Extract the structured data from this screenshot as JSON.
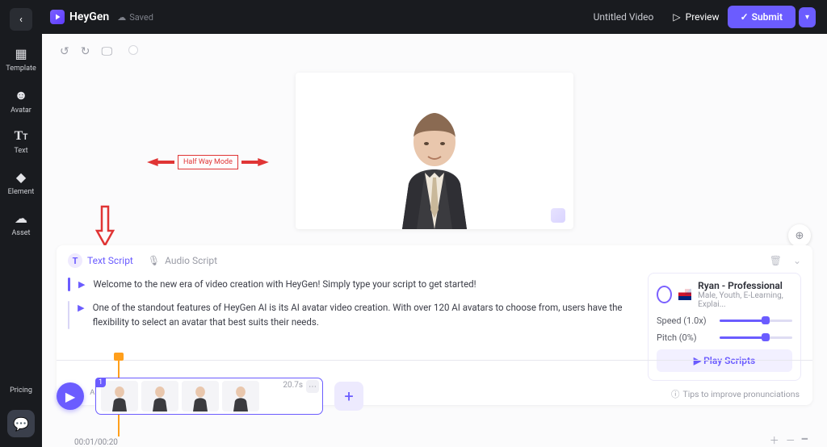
{
  "sidebar": {
    "items": [
      {
        "label": "Template"
      },
      {
        "label": "Avatar"
      },
      {
        "label": "Text"
      },
      {
        "label": "Element"
      },
      {
        "label": "Asset"
      }
    ],
    "pricing_label": "Pricing"
  },
  "header": {
    "brand": "HeyGen",
    "saved": "Saved",
    "video_title": "Untitled Video",
    "preview": "Preview",
    "submit": "Submit"
  },
  "annotation": {
    "halfway": "Half Way Mode"
  },
  "script": {
    "tabs": {
      "text": "Text Script",
      "audio": "Audio Script"
    },
    "lines": [
      "Welcome to the new era of video creation with HeyGen! Simply type your script to get started!",
      "One of the standout features of HeyGen AI is its AI avatar video creation. With over 120 AI avatars to choose from, users have the flexibility to select an avatar that best suits their needs."
    ],
    "tip": "Tips to improve pronunciations"
  },
  "voice": {
    "name": "Ryan - Professional",
    "desc": "Male, Youth, E-Learning, Explai...",
    "speed_label": "Speed (1.0x)",
    "pitch_label": "Pitch (0%)",
    "play": "Play Scripts"
  },
  "timeline": {
    "clip_index": "1",
    "duration": "20.7s",
    "time": "00:01/00:20"
  }
}
